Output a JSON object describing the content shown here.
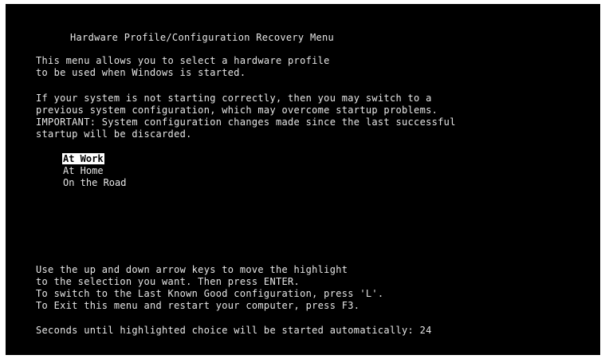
{
  "title": "Hardware Profile/Configuration Recovery Menu",
  "intro": [
    "This menu allows you to select a hardware profile",
    "to be used when Windows is started."
  ],
  "warning": [
    "If your system is not starting correctly, then you may switch to a",
    "previous system configuration, which may overcome startup problems.",
    "IMPORTANT: System configuration changes made since the last successful",
    "startup will be discarded."
  ],
  "profiles": [
    {
      "label": "At Work",
      "selected": true
    },
    {
      "label": "At Home",
      "selected": false
    },
    {
      "label": "On the Road",
      "selected": false
    }
  ],
  "instructions": [
    "Use the up and down arrow keys to move the highlight",
    "to the selection you want. Then press ENTER.",
    "To switch to the Last Known Good configuration, press 'L'.",
    "To Exit this menu and restart your computer, press F3."
  ],
  "countdown": "Seconds until highlighted choice will be started automatically: 24",
  "colors": {
    "background": "#000000",
    "text": "#e6e6e6",
    "highlight_bg": "#ffffff",
    "highlight_text": "#000000"
  }
}
